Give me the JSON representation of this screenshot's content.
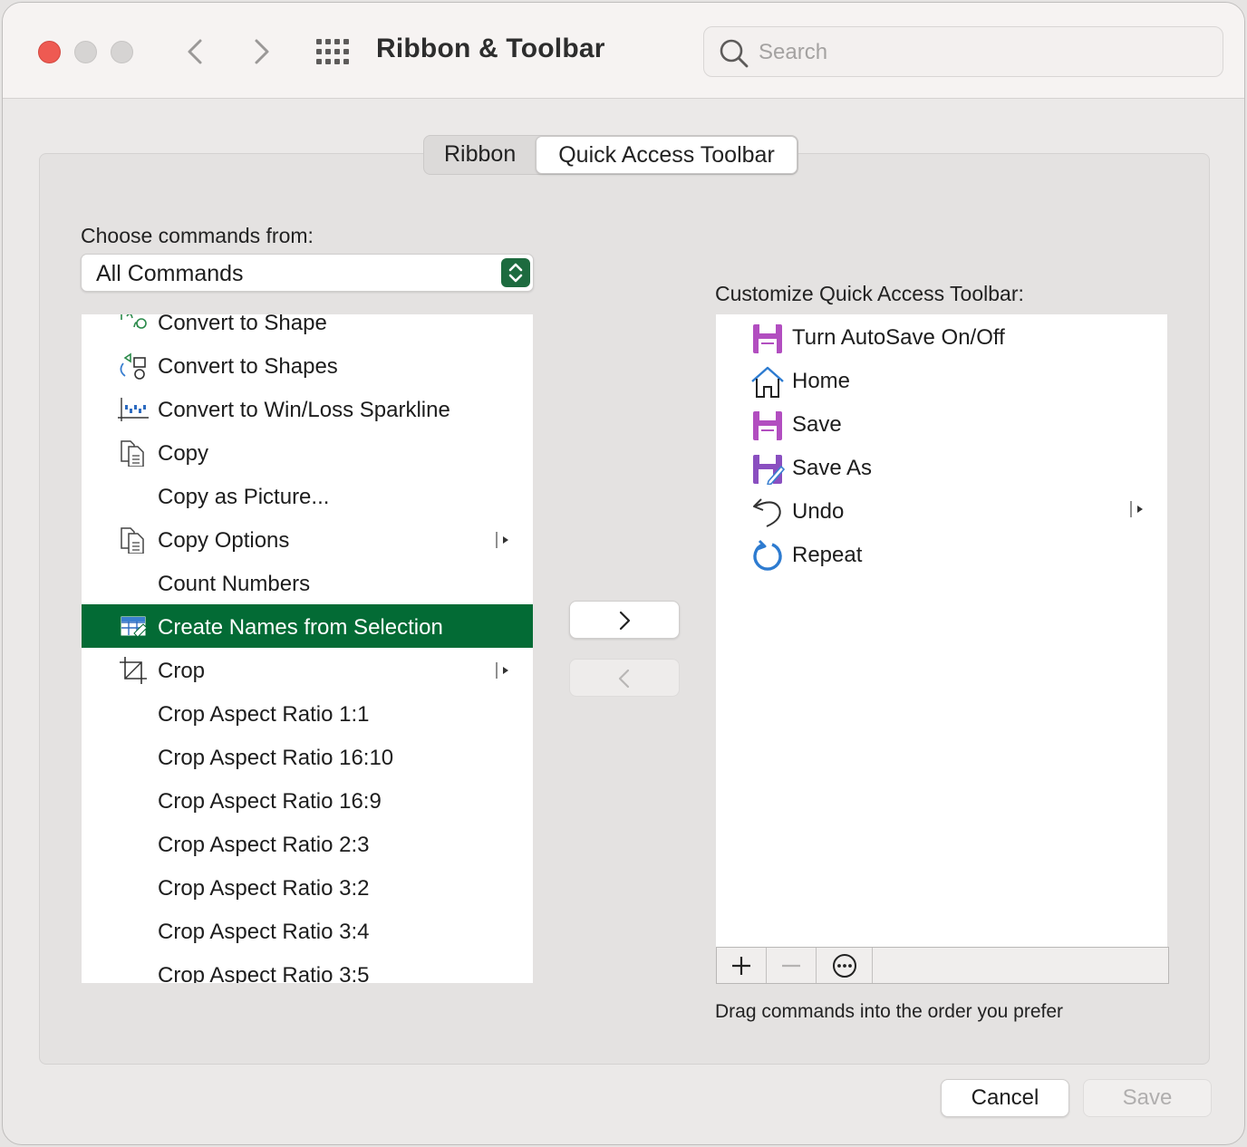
{
  "window": {
    "title": "Ribbon & Toolbar"
  },
  "search": {
    "placeholder": "Search"
  },
  "tabs": [
    {
      "label": "Ribbon",
      "active": false
    },
    {
      "label": "Quick Access Toolbar",
      "active": true
    }
  ],
  "left": {
    "label": "Choose commands from:",
    "dropdown_value": "All Commands",
    "commands": [
      {
        "label": "Convert to Shape",
        "icon": "convert-shape-icon"
      },
      {
        "label": "Convert to Shapes",
        "icon": "convert-shapes-icon"
      },
      {
        "label": "Convert to Win/Loss Sparkline",
        "icon": "sparkline-icon"
      },
      {
        "label": "Copy",
        "icon": "copy-icon"
      },
      {
        "label": "Copy as Picture...",
        "icon": ""
      },
      {
        "label": "Copy Options",
        "icon": "copy-icon",
        "submenu": true
      },
      {
        "label": "Count Numbers",
        "icon": ""
      },
      {
        "label": "Create Names from Selection",
        "icon": "create-names-icon",
        "selected": true
      },
      {
        "label": "Crop",
        "icon": "crop-icon",
        "submenu": true
      },
      {
        "label": "Crop Aspect Ratio 1:1",
        "icon": ""
      },
      {
        "label": "Crop Aspect Ratio 16:10",
        "icon": ""
      },
      {
        "label": "Crop Aspect Ratio 16:9",
        "icon": ""
      },
      {
        "label": "Crop Aspect Ratio 2:3",
        "icon": ""
      },
      {
        "label": "Crop Aspect Ratio 3:2",
        "icon": ""
      },
      {
        "label": "Crop Aspect Ratio 3:4",
        "icon": ""
      },
      {
        "label": "Crop Aspect Ratio 3:5",
        "icon": ""
      }
    ]
  },
  "right": {
    "label": "Customize Quick Access Toolbar:",
    "items": [
      {
        "label": "Turn AutoSave On/Off",
        "icon": "save-icon"
      },
      {
        "label": "Home",
        "icon": "home-icon"
      },
      {
        "label": "Save",
        "icon": "save-icon"
      },
      {
        "label": "Save As",
        "icon": "save-as-icon"
      },
      {
        "label": "Undo",
        "icon": "undo-icon",
        "submenu": true
      },
      {
        "label": "Repeat",
        "icon": "repeat-icon"
      }
    ],
    "hint": "Drag commands into the order you prefer"
  },
  "buttons": {
    "cancel": "Cancel",
    "save": "Save"
  },
  "colors": {
    "accent": "#036b35",
    "save_icon": "#b24ec0",
    "home_icon": "#2d7bd0"
  }
}
